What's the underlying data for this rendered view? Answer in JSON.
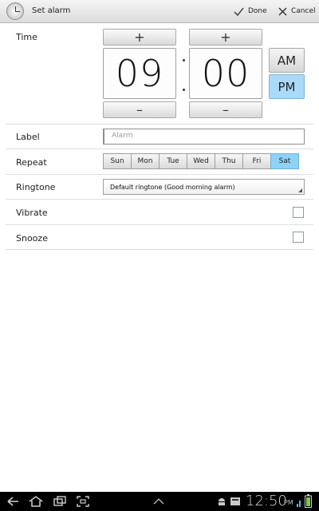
{
  "titlebar": {
    "title": "Set alarm",
    "done_label": "Done",
    "cancel_label": "Cancel"
  },
  "time": {
    "label": "Time",
    "increment_symbol": "+",
    "decrement_symbol": "–",
    "hour": "09",
    "minute": "00",
    "am_label": "AM",
    "pm_label": "PM",
    "selected_period": "PM"
  },
  "label": {
    "label": "Label",
    "placeholder": "Alarm"
  },
  "repeat": {
    "label": "Repeat",
    "days": [
      "Sun",
      "Mon",
      "Tue",
      "Wed",
      "Thu",
      "Fri",
      "Sat"
    ],
    "selected": [
      "Sat"
    ]
  },
  "ringtone": {
    "label": "Ringtone",
    "value": "Default ringtone (Good morning alarm)"
  },
  "vibrate": {
    "label": "Vibrate",
    "checked": false
  },
  "snooze": {
    "label": "Snooze",
    "checked": false
  },
  "system_bar": {
    "time": "12:50",
    "ampm": "PM",
    "icons": [
      "back-icon",
      "home-icon",
      "recent-apps-icon",
      "screenshot-icon",
      "up-arrow-icon",
      "android-icon",
      "sd-card-icon",
      "battery-icon"
    ]
  },
  "colors": {
    "selected_accent": "#a9dbf9",
    "selected_day": "#8fd2f7"
  }
}
